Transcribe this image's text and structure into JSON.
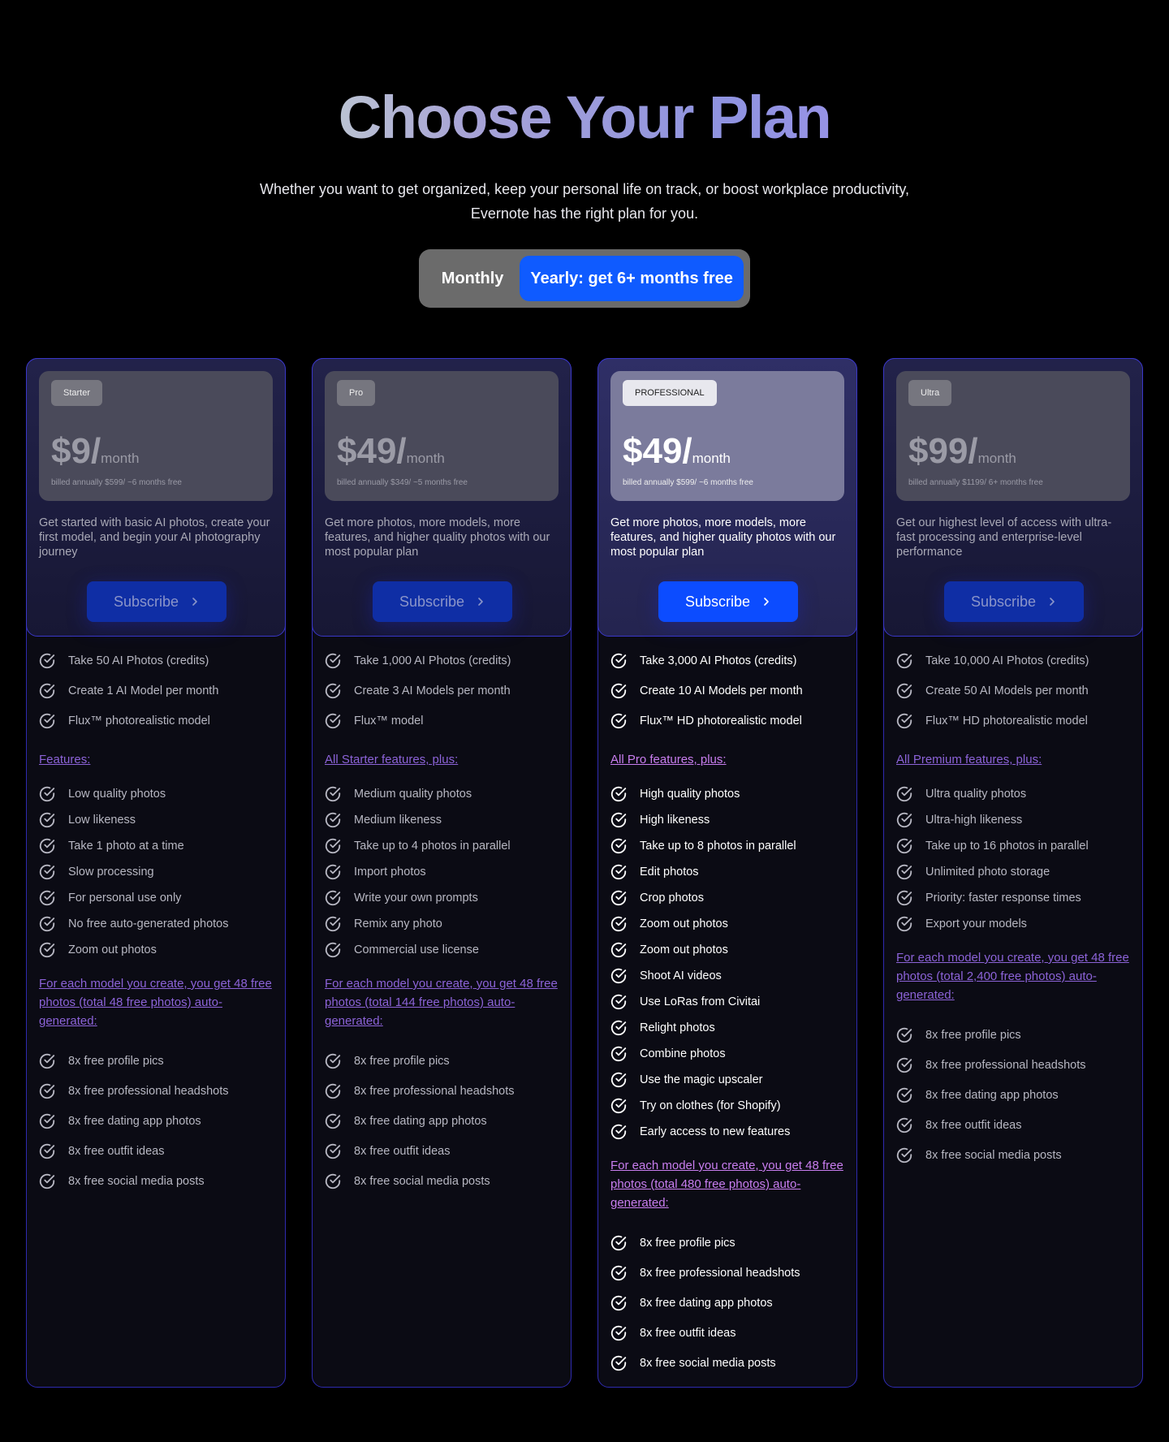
{
  "header": {
    "title": "Choose Your Plan",
    "subtitle_line1": "Whether you want to get organized, keep your personal life on track, or boost workplace productivity,",
    "subtitle_line2": "Evernote has the right plan for you."
  },
  "billing_toggle": {
    "monthly_label": "Monthly",
    "yearly_label": "Yearly: get 6+ months free",
    "selected": "yearly"
  },
  "plans": [
    {
      "badge": "Starter",
      "price": "$9/",
      "per": "month",
      "billed": "billed annually $599/ ~6 months free",
      "description": "Get started with basic AI photos, create your first model, and begin your AI photography journey",
      "subscribe_label": "Subscribe",
      "basics": [
        "Take 50 AI Photos (credits)",
        "Create 1 AI Model per month",
        "Flux™ photorealistic model"
      ],
      "features_heading": "Features:",
      "features": [
        "Low quality photos",
        "Low likeness",
        "Take 1 photo at a time",
        "Slow processing",
        "For personal use only",
        "No free auto-generated photos",
        "Zoom out photos"
      ],
      "bonus_heading": "For each model you create, you get 48 free photos (total 48 free photos) auto-generated:",
      "bonus": [
        "8x free profile pics",
        "8x free professional headshots",
        "8x free dating app photos",
        "8x free outfit ideas",
        "8x free social media posts"
      ]
    },
    {
      "badge": "Pro",
      "price": "$49/",
      "per": "month",
      "billed": "billed annually  $349/ ~5  months free",
      "description": "Get more photos, more models, more features, and higher quality photos with our most popular plan",
      "subscribe_label": "Subscribe",
      "basics": [
        "Take 1,000 AI Photos (credits)",
        "Create 3 AI Models per month",
        "Flux™ model"
      ],
      "features_heading": " All Starter features, plus:",
      "features": [
        "Medium quality photos",
        "Medium likeness",
        "Take up to 4 photos in parallel",
        "Import photos",
        "Write your own prompts",
        "Remix any photo",
        "Commercial use license"
      ],
      "bonus_heading": "For each model you create, you get 48 free photos (total 144 free photos) auto-generated:",
      "bonus": [
        "8x free profile pics",
        "8x free professional headshots",
        "8x free dating app photos",
        "8x free outfit ideas",
        "8x free social media posts"
      ]
    },
    {
      "badge": "PROFESSIONAL",
      "price": "$49/",
      "per": "month",
      "billed": "billed annually $599/ ~6 months free",
      "description": "Get more photos, more models, more features, and higher quality photos with our most popular plan",
      "subscribe_label": "Subscribe",
      "basics": [
        "Take 3,000 AI Photos (credits)",
        "Create 10 AI Models per month",
        "Flux™ HD photorealistic model"
      ],
      "features_heading": " All Pro features, plus:",
      "features": [
        "High quality photos",
        "High likeness",
        "Take up to 8 photos in parallel",
        "Edit photos",
        "Crop photos",
        "Zoom out photos",
        "Zoom out photos",
        "Shoot AI videos",
        "Use LoRas from Civitai",
        "Relight photos",
        "Combine photos",
        "Use the magic upscaler",
        "Try on clothes (for Shopify)",
        "Early access to new features"
      ],
      "bonus_heading": "For each model you create, you get 48 free photos (total 480 free photos) auto-generated:",
      "bonus": [
        "8x free profile pics",
        "8x free professional headshots",
        "8x free dating app photos",
        "8x free outfit ideas",
        "8x free social media posts"
      ]
    },
    {
      "badge": "Ultra",
      "price": "$99/",
      "per": "month",
      "billed": "billed annually $1199/ 6+ months free",
      "description": "Get our highest level of access with ultra-fast processing and enterprise-level performance",
      "subscribe_label": "Subscribe",
      "basics": [
        "Take 10,000 AI Photos (credits)",
        "Create 50 AI Models per month",
        "Flux™ HD photorealistic model"
      ],
      "features_heading": " All Premium features, plus:",
      "features": [
        "Ultra quality photos",
        "Ultra-high likeness",
        "Take up to 16 photos in parallel",
        "Unlimited photo storage",
        "Priority: faster response times",
        "Export your models"
      ],
      "bonus_heading": "For each model you create, you get 48 free photos (total 2,400 free photos) auto-generated:",
      "bonus": [
        "8x free profile pics",
        "8x free professional headshots",
        "8x free dating app photos",
        "8x free outfit ideas",
        "8x free social media posts"
      ]
    }
  ]
}
